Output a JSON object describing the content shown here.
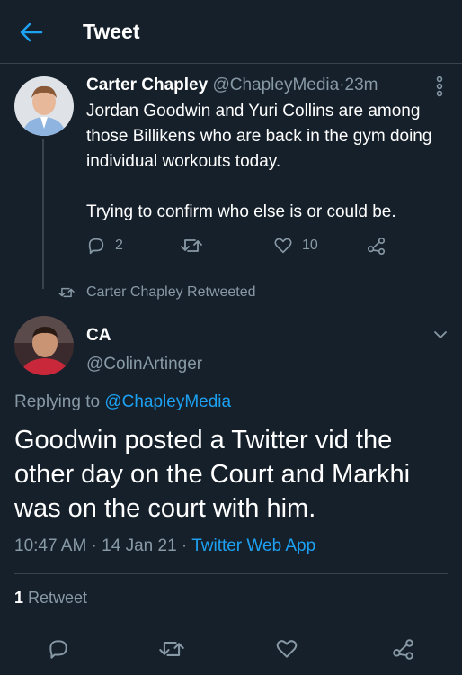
{
  "header": {
    "title": "Tweet"
  },
  "tweet1": {
    "name": "Carter Chapley",
    "handle": "@ChapleyMedia",
    "time": "23m",
    "dot": "·",
    "text_p1": "Jordan Goodwin and Yuri Collins are among those Billikens who are back in the gym doing individual workouts today.",
    "text_p2": "Trying to confirm who else is or could be.",
    "replies": "2",
    "likes": "10"
  },
  "retweet_note": {
    "text": "Carter Chapley Retweeted"
  },
  "tweet2": {
    "name": "CA",
    "handle": "@ColinArtinger",
    "replying_prefix": "Replying to ",
    "replying_to": "@ChapleyMedia",
    "text": "Goodwin posted a Twitter vid the other day on the Court and Markhi was on the court with him.",
    "time": "10:47 AM",
    "date": "14 Jan 21",
    "source": "Twitter Web App",
    "dot": " · ",
    "retweet_count": "1",
    "retweet_label": " Retweet"
  },
  "colors": {
    "background": "#15202b",
    "accent": "#1da1f2",
    "muted": "#8899a6",
    "border": "#38444d"
  },
  "icons": [
    "back-arrow-icon",
    "more-vertical-icon",
    "reply-icon",
    "retweet-icon",
    "like-icon",
    "share-icon",
    "chevron-down-icon"
  ]
}
